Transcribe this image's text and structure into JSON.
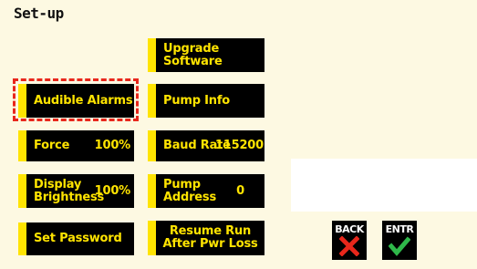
{
  "screen": {
    "title": "Set-up"
  },
  "buttons": {
    "audible_alarms": {
      "label": "Audible Alarms"
    },
    "force": {
      "label": "Force",
      "value": "100%"
    },
    "display_brightness": {
      "label": "Display\nBrightness",
      "value": "100%"
    },
    "set_password": {
      "label": "Set Password"
    },
    "upgrade_software": {
      "label": "Upgrade\nSoftware"
    },
    "pump_info": {
      "label": "Pump Info"
    },
    "baud_rate": {
      "label": "Baud Rate",
      "value": "115200"
    },
    "pump_address": {
      "label": "Pump\nAddress",
      "value": "0"
    },
    "resume_run": {
      "label": "Resume Run\nAfter Pwr Loss"
    }
  },
  "actions": {
    "back": {
      "label": "BACK",
      "icon": "x-icon",
      "color": "#e8271b"
    },
    "enter": {
      "label": "ENTR",
      "icon": "check-icon",
      "color": "#2fb84a"
    }
  },
  "colors": {
    "background": "#fdf9e2",
    "button_bg": "#000000",
    "button_text": "#ffe400",
    "selection_outline": "#e8271b"
  }
}
